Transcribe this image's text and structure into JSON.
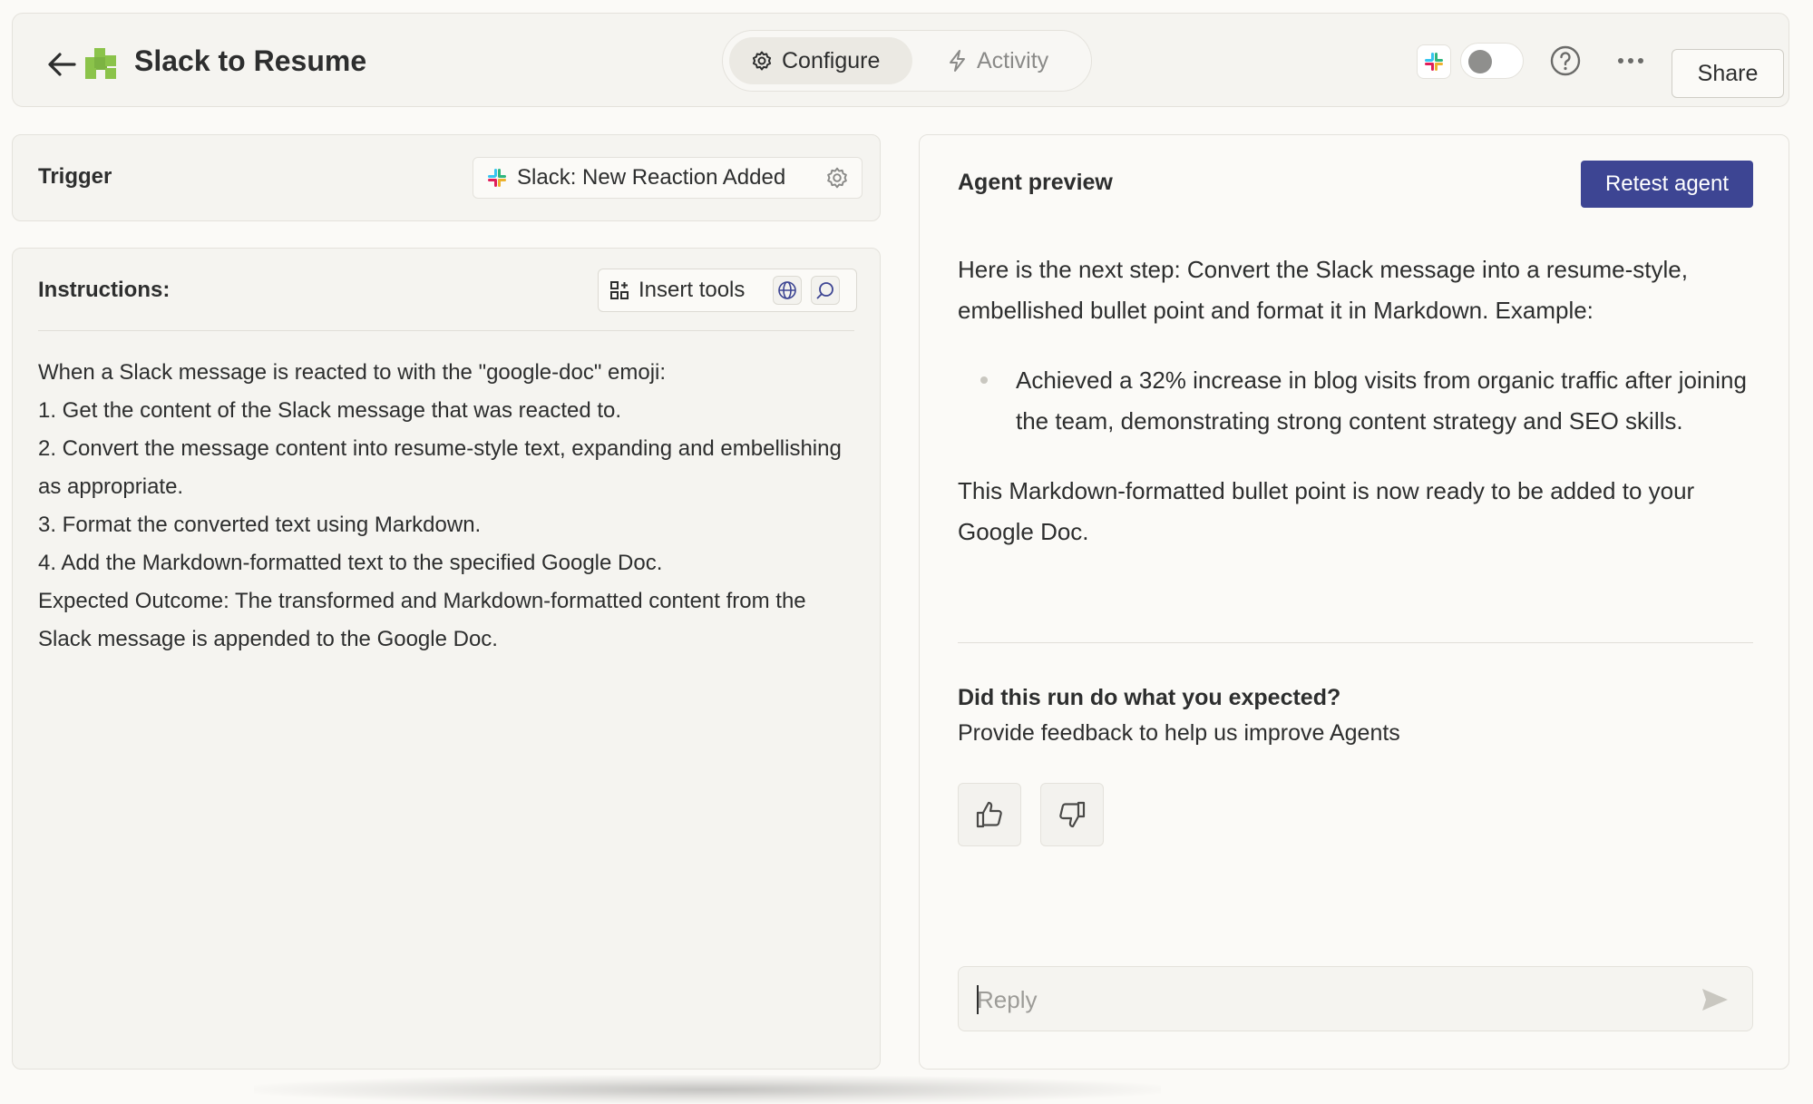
{
  "header": {
    "title": "Slack to Resume",
    "tabs": [
      {
        "label": "Configure",
        "icon": "gear-icon",
        "active": true
      },
      {
        "label": "Activity",
        "icon": "lightning-icon",
        "active": false
      }
    ],
    "toggle_on": false,
    "share_label": "Share"
  },
  "trigger": {
    "label": "Trigger",
    "value": "Slack: New Reaction Added"
  },
  "instructions": {
    "label": "Instructions:",
    "insert_tools_label": "Insert tools",
    "lines": [
      "When a Slack message is reacted to with the \"google-doc\" emoji:",
      "1. Get the content of the Slack message that was reacted to.",
      "2. Convert the message content into resume-style text, expanding and embellishing as appropriate.",
      "3. Format the converted text using Markdown.",
      "4. Add the Markdown-formatted text to the specified Google Doc.",
      "Expected Outcome: The transformed and Markdown-formatted content from the Slack message is appended to the Google Doc."
    ]
  },
  "preview": {
    "title": "Agent preview",
    "retest_label": "Retest agent",
    "intro": "Here is the next step: Convert the Slack message into a resume-style, embellished bullet point and format it in Markdown. Example:",
    "bullet": "Achieved a 32% increase in blog visits from organic traffic after joining the team, demonstrating strong content strategy and SEO skills.",
    "outro": "This Markdown-formatted bullet point is now ready to be added to your Google Doc.",
    "feedback_question": "Did this run do what you expected?",
    "feedback_sub": "Provide feedback to help us improve Agents",
    "reply_placeholder": "Reply"
  },
  "colors": {
    "primary_button": "#3d4593",
    "logo_green": "#8bc34a",
    "background": "#fbfaf7"
  }
}
